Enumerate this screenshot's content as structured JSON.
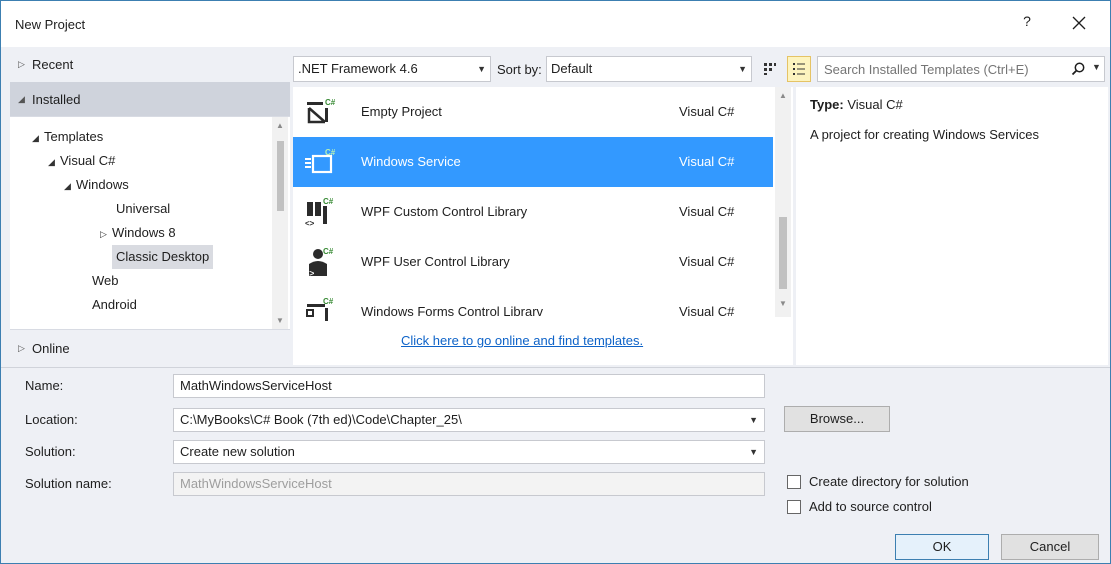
{
  "window": {
    "title": "New Project",
    "help_glyph": "?"
  },
  "nav": {
    "recent": "Recent",
    "installed": "Installed",
    "online": "Online",
    "tree": [
      {
        "label": "Templates"
      },
      {
        "label": "Visual C#"
      },
      {
        "label": "Windows"
      },
      {
        "label": "Universal"
      },
      {
        "label": "Windows 8"
      },
      {
        "label": "Classic Desktop"
      },
      {
        "label": "Web"
      },
      {
        "label": "Android"
      }
    ]
  },
  "toolbar": {
    "framework": ".NET Framework 4.6",
    "sort_label": "Sort by:",
    "sort_value": "Default",
    "search_placeholder": "Search Installed Templates (Ctrl+E)"
  },
  "templates": [
    {
      "name": "Empty Project",
      "lang": "Visual C#",
      "icon": "empty-project-icon"
    },
    {
      "name": "Windows Service",
      "lang": "Visual C#",
      "icon": "windows-service-icon",
      "selected": true
    },
    {
      "name": "WPF Custom Control Library",
      "lang": "Visual C#",
      "icon": "wpf-custom-control-icon"
    },
    {
      "name": "WPF User Control Library",
      "lang": "Visual C#",
      "icon": "wpf-user-control-icon"
    },
    {
      "name": "Windows Forms Control Librarv",
      "lang": "Visual C#",
      "icon": "winforms-control-icon"
    }
  ],
  "online_link": "Click here to go online and find templates.",
  "details": {
    "type_label": "Type:",
    "type_value": "Visual C#",
    "description": "A project for creating Windows Services"
  },
  "form": {
    "name_label": "Name:",
    "name_value": "MathWindowsServiceHost",
    "location_label": "Location:",
    "location_value": "C:\\MyBooks\\C# Book (7th ed)\\Code\\Chapter_25\\",
    "solution_label": "Solution:",
    "solution_value": "Create new solution",
    "solution_name_label": "Solution name:",
    "solution_name_value": "MathWindowsServiceHost",
    "browse_label": "Browse...",
    "create_dir_label": "Create directory for solution",
    "source_control_label": "Add to source control",
    "ok_label": "OK",
    "cancel_label": "Cancel"
  },
  "colors": {
    "accent": "#3399ff",
    "link": "#0e63c8",
    "selection_bg": "#d9dbe1"
  }
}
